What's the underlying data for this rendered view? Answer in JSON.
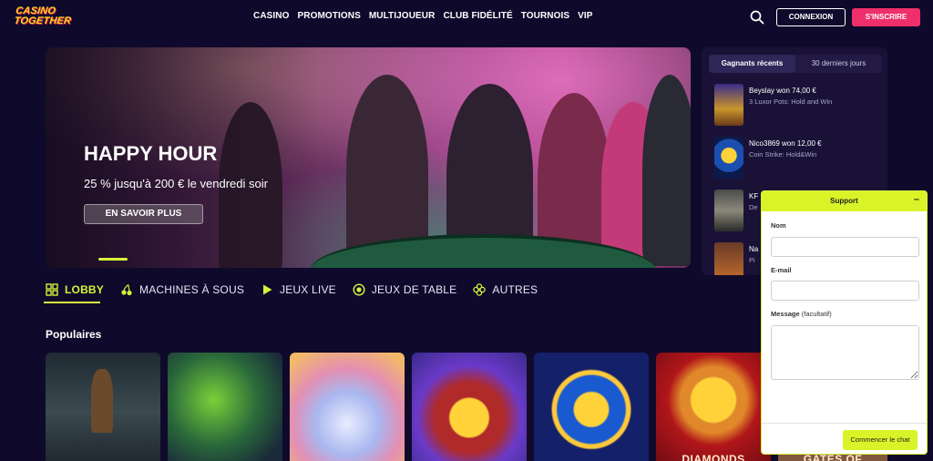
{
  "header": {
    "logo_line1": "CASINO",
    "logo_line2": "TOGETHER",
    "nav": [
      "CASINO",
      "PROMOTIONS",
      "MULTIJOUEUR",
      "CLUB FIDÉLITÉ",
      "TOURNOIS",
      "VIP"
    ],
    "login_label": "CONNEXION",
    "signup_label": "S'INSCRIRE"
  },
  "hero": {
    "title": "HAPPY HOUR",
    "subtitle": "25 % jusqu'à 200 € le vendredi soir",
    "cta": "EN SAVOIR PLUS"
  },
  "winners": {
    "tabs": [
      "Gagnants récents",
      "30 derniers jours"
    ],
    "items": [
      {
        "title": "Beyslay won 74,00 €",
        "game": "3 Luxor Pots: Hold and Win"
      },
      {
        "title": "Nico3869 won 12,00 €",
        "game": "Coin Strike: Hold&Win"
      },
      {
        "title": "KF",
        "game": "De"
      },
      {
        "title": "Na",
        "game": "Pi"
      }
    ]
  },
  "categories": [
    "LOBBY",
    "MACHINES À SOUS",
    "JEUX LIVE",
    "JEUX DE TABLE",
    "AUTRES"
  ],
  "section_title": "Populaires",
  "tiles": [
    {
      "caption": ""
    },
    {
      "caption": ""
    },
    {
      "caption": ""
    },
    {
      "caption": ""
    },
    {
      "caption": ""
    },
    {
      "caption": "DIAMONDS"
    },
    {
      "caption": "GATES OF"
    }
  ],
  "support": {
    "title": "Support",
    "minimize": "–",
    "name_label": "Nom",
    "email_label": "E-mail",
    "message_label": "Message",
    "message_optional": "(facultatif)",
    "send_label": "Commencer le chat"
  },
  "colors": {
    "background": "#0f0a2b",
    "accent": "#d6f23a",
    "signup": "#ee2f6b"
  }
}
